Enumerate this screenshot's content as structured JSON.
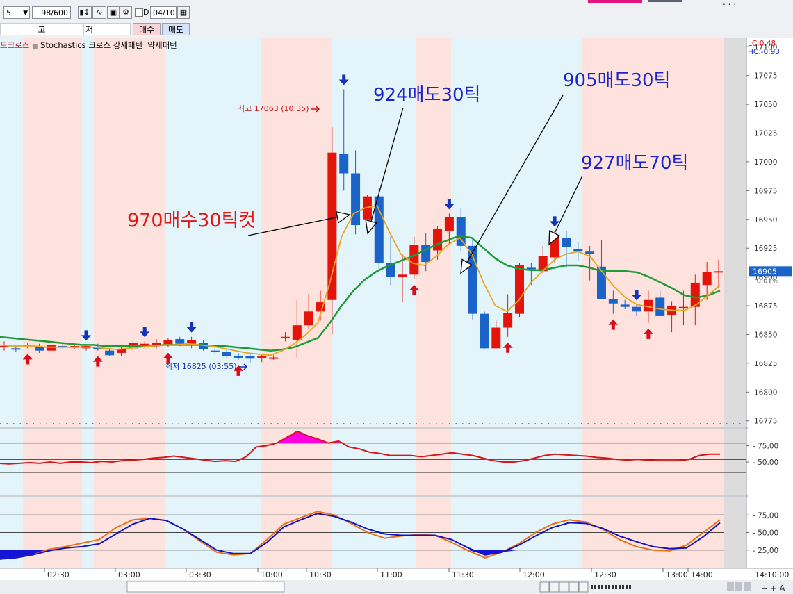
{
  "toolbar": {
    "period": "5",
    "count": "98/600",
    "d_label": "D",
    "date": "04/10",
    "price_type_1": "고",
    "price_type_2": "저",
    "buy_button": "매수",
    "sell_button": "매도"
  },
  "legend": {
    "item_dead_cross": "드크로스",
    "item_stoch_cross": "Stochastics 크로스",
    "item_strong": "강세패턴",
    "item_weak": "약세패턴"
  },
  "right_info": {
    "lc": "LC:0.48",
    "hc": "HC:-0.93"
  },
  "annotations": {
    "high_label": "최고 17063 (10:35)",
    "low_label": "최저 16825 (03:55)",
    "note_buy": "970매수30틱컷",
    "note_sell1": "924매도30틱",
    "note_sell2": "905매도30틱",
    "note_sell3": "927매도70틱"
  },
  "colors": {
    "up": "#e3150a",
    "down": "#1a63c9",
    "ma_fast": "#e8a520",
    "ma_slow": "#1e9a36",
    "osc1": "#d3171b",
    "stoch_k": "#1212c8",
    "stoch_d": "#ea6e12",
    "buy_arrow": "#d60d1a",
    "sell_arrow": "#1433b8",
    "note_red": "#e31515",
    "note_blue": "#1d24c9",
    "band_pink": "#fde2dd",
    "band_blue": "#e3f5fb"
  },
  "chart_data": [
    {
      "type": "candlestick",
      "title": "",
      "y_ticks": [
        17100,
        17075,
        17050,
        17025,
        17000,
        16975,
        16950,
        16925,
        16900,
        16875,
        16850,
        16825,
        16800,
        16775
      ],
      "ylim": [
        16770,
        17108
      ],
      "x_ticks": [
        "02:30",
        "03:00",
        "03:30",
        "10:00",
        "10:30",
        "11:00",
        "11:30",
        "12:00",
        "12:30",
        "13:00",
        "14:00",
        "14:10:00"
      ],
      "current_price": "16905",
      "current_change": "-0.01%",
      "candles": [
        {
          "o": 16840,
          "h": 16844,
          "l": 16836,
          "c": 16840
        },
        {
          "o": 16838,
          "h": 16841,
          "l": 16835,
          "c": 16837
        },
        {
          "o": 16841,
          "h": 16843,
          "l": 16838,
          "c": 16840
        },
        {
          "o": 16839,
          "h": 16842,
          "l": 16834,
          "c": 16836
        },
        {
          "o": 16836,
          "h": 16842,
          "l": 16834,
          "c": 16841
        },
        {
          "o": 16840,
          "h": 16843,
          "l": 16837,
          "c": 16839
        },
        {
          "o": 16840,
          "h": 16842,
          "l": 16837,
          "c": 16840
        },
        {
          "o": 16838,
          "h": 16841,
          "l": 16836,
          "c": 16840
        },
        {
          "o": 16839,
          "h": 16842,
          "l": 16836,
          "c": 16837
        },
        {
          "o": 16836,
          "h": 16838,
          "l": 16831,
          "c": 16832
        },
        {
          "o": 16834,
          "h": 16840,
          "l": 16831,
          "c": 16837
        },
        {
          "o": 16838,
          "h": 16845,
          "l": 16836,
          "c": 16843
        },
        {
          "o": 16842,
          "h": 16844,
          "l": 16838,
          "c": 16842
        },
        {
          "o": 16840,
          "h": 16846,
          "l": 16838,
          "c": 16843
        },
        {
          "o": 16841,
          "h": 16847,
          "l": 16839,
          "c": 16845
        },
        {
          "o": 16846,
          "h": 16848,
          "l": 16840,
          "c": 16842
        },
        {
          "o": 16842,
          "h": 16848,
          "l": 16838,
          "c": 16845
        },
        {
          "o": 16843,
          "h": 16845,
          "l": 16836,
          "c": 16837
        },
        {
          "o": 16836,
          "h": 16839,
          "l": 16833,
          "c": 16835
        },
        {
          "o": 16835,
          "h": 16837,
          "l": 16829,
          "c": 16831
        },
        {
          "o": 16831,
          "h": 16834,
          "l": 16828,
          "c": 16830
        },
        {
          "o": 16831,
          "h": 16834,
          "l": 16825,
          "c": 16829
        },
        {
          "o": 16830,
          "h": 16833,
          "l": 16826,
          "c": 16831
        },
        {
          "o": 16830,
          "h": 16832,
          "l": 16828,
          "c": 16830
        },
        {
          "o": 16848,
          "h": 16852,
          "l": 16844,
          "c": 16848
        },
        {
          "o": 16845,
          "h": 16880,
          "l": 16830,
          "c": 16858
        },
        {
          "o": 16858,
          "h": 16885,
          "l": 16855,
          "c": 16870
        },
        {
          "o": 16870,
          "h": 16888,
          "l": 16862,
          "c": 16878
        },
        {
          "o": 16880,
          "h": 17030,
          "l": 16850,
          "c": 17008
        },
        {
          "o": 17007,
          "h": 17063,
          "l": 16975,
          "c": 16990
        },
        {
          "o": 16990,
          "h": 17010,
          "l": 16937,
          "c": 16945
        },
        {
          "o": 16950,
          "h": 16971,
          "l": 16940,
          "c": 16970
        },
        {
          "o": 16970,
          "h": 16977,
          "l": 16904,
          "c": 16912
        },
        {
          "o": 16912,
          "h": 16935,
          "l": 16893,
          "c": 16900
        },
        {
          "o": 16900,
          "h": 16920,
          "l": 16878,
          "c": 16902
        },
        {
          "o": 16902,
          "h": 16935,
          "l": 16898,
          "c": 16928
        },
        {
          "o": 16928,
          "h": 16938,
          "l": 16905,
          "c": 16913
        },
        {
          "o": 16923,
          "h": 16944,
          "l": 16915,
          "c": 16942
        },
        {
          "o": 16940,
          "h": 16955,
          "l": 16928,
          "c": 16952
        },
        {
          "o": 16952,
          "h": 16960,
          "l": 16922,
          "c": 16927
        },
        {
          "o": 16927,
          "h": 16932,
          "l": 16863,
          "c": 16868
        },
        {
          "o": 16868,
          "h": 16870,
          "l": 16837,
          "c": 16838
        },
        {
          "o": 16838,
          "h": 16862,
          "l": 16838,
          "c": 16856
        },
        {
          "o": 16856,
          "h": 16885,
          "l": 16848,
          "c": 16869
        },
        {
          "o": 16868,
          "h": 16912,
          "l": 16865,
          "c": 16910
        },
        {
          "o": 16908,
          "h": 16912,
          "l": 16893,
          "c": 16907
        },
        {
          "o": 16905,
          "h": 16927,
          "l": 16903,
          "c": 16918
        },
        {
          "o": 16917,
          "h": 16940,
          "l": 16912,
          "c": 16935
        },
        {
          "o": 16934,
          "h": 16940,
          "l": 16908,
          "c": 16926
        },
        {
          "o": 16924,
          "h": 16930,
          "l": 16914,
          "c": 16922
        },
        {
          "o": 16922,
          "h": 16927,
          "l": 16897,
          "c": 16920
        },
        {
          "o": 16909,
          "h": 16932,
          "l": 16902,
          "c": 16881
        },
        {
          "o": 16881,
          "h": 16888,
          "l": 16868,
          "c": 16877
        },
        {
          "o": 16876,
          "h": 16880,
          "l": 16872,
          "c": 16874
        },
        {
          "o": 16874,
          "h": 16876,
          "l": 16866,
          "c": 16870
        },
        {
          "o": 16870,
          "h": 16888,
          "l": 16860,
          "c": 16880
        },
        {
          "o": 16882,
          "h": 16888,
          "l": 16866,
          "c": 16866
        },
        {
          "o": 16867,
          "h": 16879,
          "l": 16852,
          "c": 16875
        },
        {
          "o": 16874,
          "h": 16888,
          "l": 16858,
          "c": 16874
        },
        {
          "o": 16874,
          "h": 16902,
          "l": 16858,
          "c": 16895
        },
        {
          "o": 16893,
          "h": 16913,
          "l": 16880,
          "c": 16904
        },
        {
          "o": 16905,
          "h": 16915,
          "l": 16890,
          "c": 16905
        }
      ],
      "ma_fast": [
        16841,
        16840,
        16840,
        16840,
        16839,
        16839,
        16839,
        16839,
        16839,
        16838,
        16837,
        16838,
        16839,
        16840,
        16841,
        16841,
        16842,
        16841,
        16840,
        16838,
        16836,
        16834,
        16833,
        16832,
        16836,
        16842,
        16850,
        16860,
        16895,
        16935,
        16955,
        16960,
        16962,
        16940,
        16920,
        16912,
        16910,
        16918,
        16928,
        16934,
        16920,
        16895,
        16875,
        16870,
        16880,
        16895,
        16905,
        16915,
        16920,
        16922,
        16918,
        16905,
        16892,
        16882,
        16876,
        16874,
        16872,
        16871,
        16871,
        16876,
        16884,
        16893
      ],
      "ma_slow": [
        16848,
        16847,
        16846,
        16845,
        16844,
        16843,
        16842,
        16841,
        16841,
        16840,
        16840,
        16840,
        16840,
        16840,
        16841,
        16841,
        16841,
        16841,
        16840,
        16840,
        16839,
        16838,
        16837,
        16836,
        16837,
        16839,
        16843,
        16847,
        16860,
        16875,
        16888,
        16898,
        16905,
        16910,
        16914,
        16918,
        16923,
        16928,
        16932,
        16936,
        16934,
        16925,
        16916,
        16910,
        16907,
        16906,
        16906,
        16908,
        16910,
        16910,
        16908,
        16905,
        16905,
        16905,
        16904,
        16900,
        16895,
        16890,
        16884,
        16882,
        16884,
        16888
      ],
      "buy_signal_bars": [
        2,
        8,
        14,
        20,
        35,
        43,
        52,
        55
      ],
      "sell_signal_bars": [
        7,
        12,
        16,
        29,
        38,
        47,
        54
      ]
    },
    {
      "type": "line",
      "title": "",
      "y_ticks": [
        75,
        50
      ],
      "hlines": [
        79,
        54,
        34
      ],
      "values": [
        48,
        47,
        48,
        49,
        48,
        50,
        48,
        50,
        50,
        49,
        51,
        50,
        52,
        53,
        54,
        56,
        57,
        59,
        57,
        55,
        53,
        51,
        52,
        51,
        58,
        73,
        75,
        79,
        88,
        97,
        90,
        85,
        79,
        82,
        73,
        70,
        65,
        63,
        60,
        60,
        60,
        58,
        60,
        62,
        64,
        62,
        60,
        56,
        52,
        50,
        50,
        52,
        56,
        60,
        62,
        61,
        60,
        59,
        57,
        56,
        54,
        53,
        54,
        53,
        52,
        52,
        52,
        54,
        60,
        62,
        62
      ]
    },
    {
      "type": "line",
      "title": "",
      "y_ticks": [
        75,
        50,
        25
      ],
      "hlines": [
        75,
        50,
        25
      ],
      "series": [
        {
          "values": [
            12,
            14,
            18,
            24,
            28,
            30,
            34,
            48,
            62,
            70,
            67,
            55,
            40,
            25,
            20,
            20,
            36,
            58,
            68,
            77,
            73,
            65,
            55,
            48,
            46,
            46,
            46,
            40,
            28,
            18,
            22,
            32,
            45,
            57,
            64,
            63,
            56,
            45,
            37,
            30,
            27,
            28,
            44,
            64
          ]
        },
        {
          "values": [
            12,
            14,
            18,
            26,
            30,
            35,
            40,
            57,
            68,
            70,
            67,
            55,
            38,
            22,
            18,
            20,
            40,
            62,
            71,
            80,
            75,
            63,
            50,
            42,
            45,
            47,
            46,
            36,
            24,
            14,
            22,
            34,
            50,
            62,
            68,
            65,
            55,
            40,
            30,
            25,
            24,
            32,
            50,
            68
          ]
        }
      ]
    }
  ]
}
